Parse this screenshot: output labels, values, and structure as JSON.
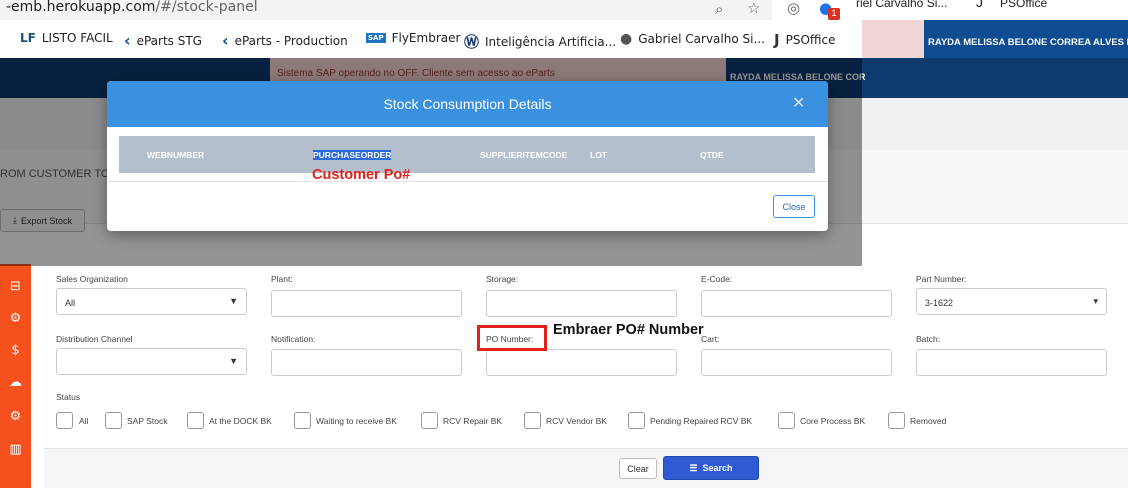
{
  "browser": {
    "url_scheme": "-emb.herokuapp.com",
    "url_rest": "/#/stock-panel",
    "zoom_icon": "zoom-icon",
    "star_icon": "star-icon",
    "ext_badge": "1",
    "profile_1": "riel Carvalho Si...",
    "profile_2": "PSOffice"
  },
  "bookmarks": [
    {
      "label": "LISTO FACIL",
      "icon": "LF"
    },
    {
      "label": "eParts STG",
      "icon": "‹"
    },
    {
      "label": "eParts - Production",
      "icon": "‹"
    },
    {
      "label": "FlyEmbraer",
      "icon": "SAP"
    },
    {
      "label": "Inteligência Artificia...",
      "icon": "Ⓦ"
    },
    {
      "label": "Gabriel Carvalho Si...",
      "icon": "●"
    },
    {
      "label": "PSOffice",
      "icon": "J"
    }
  ],
  "header": {
    "user_tab": "RAYDA MELISSA BELONE CORREA ALVES NA",
    "user_top": "RAYDA MELISSA BELONE COR",
    "sap_banner": "Sistema SAP operando no OFF. Cliente sem acesso ao eParts"
  },
  "page": {
    "customer_text": "ROM CUSTOMER TO",
    "export_label": "Export Stock"
  },
  "modal": {
    "title": "Stock Consumption Details",
    "columns": [
      "WEBNUMBER",
      "PURCHASEORDER",
      "SUPPLIERITEMCODE",
      "LOT",
      "QTDE"
    ],
    "close_label": "Close"
  },
  "annotations": {
    "customer_po": "Customer Po#",
    "embraer_po": "Embraer PO# Number"
  },
  "filters": {
    "sales_org_label": "Sales Organization",
    "sales_org_value": "All",
    "plant_label": "Plant:",
    "storage_label": "Storage:",
    "ecode_label": "E-Code:",
    "part_number_label": "Part Number:",
    "part_number_value": "3-1622",
    "dist_channel_label": "Distribution Channel",
    "notification_label": "Notification:",
    "po_number_label": "PO Number:",
    "cart_label": "Cart:",
    "batch_label": "Batch:",
    "status_label": "Status",
    "status_options": [
      "All",
      "SAP Stock",
      "At the DOCK BK",
      "Waiting to receive BK",
      "RCV Repair BK",
      "RCV Vendor BK",
      "Pending Repaired RCV BK",
      "Core Process BK",
      "Removed"
    ]
  },
  "buttons": {
    "clear": "Clear",
    "search": "Search"
  },
  "colors": {
    "sidebar": "#f4511e",
    "modal_header": "#3a91df",
    "search_button": "#2e5bd2",
    "annotation_red": "#e0221b",
    "nav_blue": "#0e3a6e"
  }
}
